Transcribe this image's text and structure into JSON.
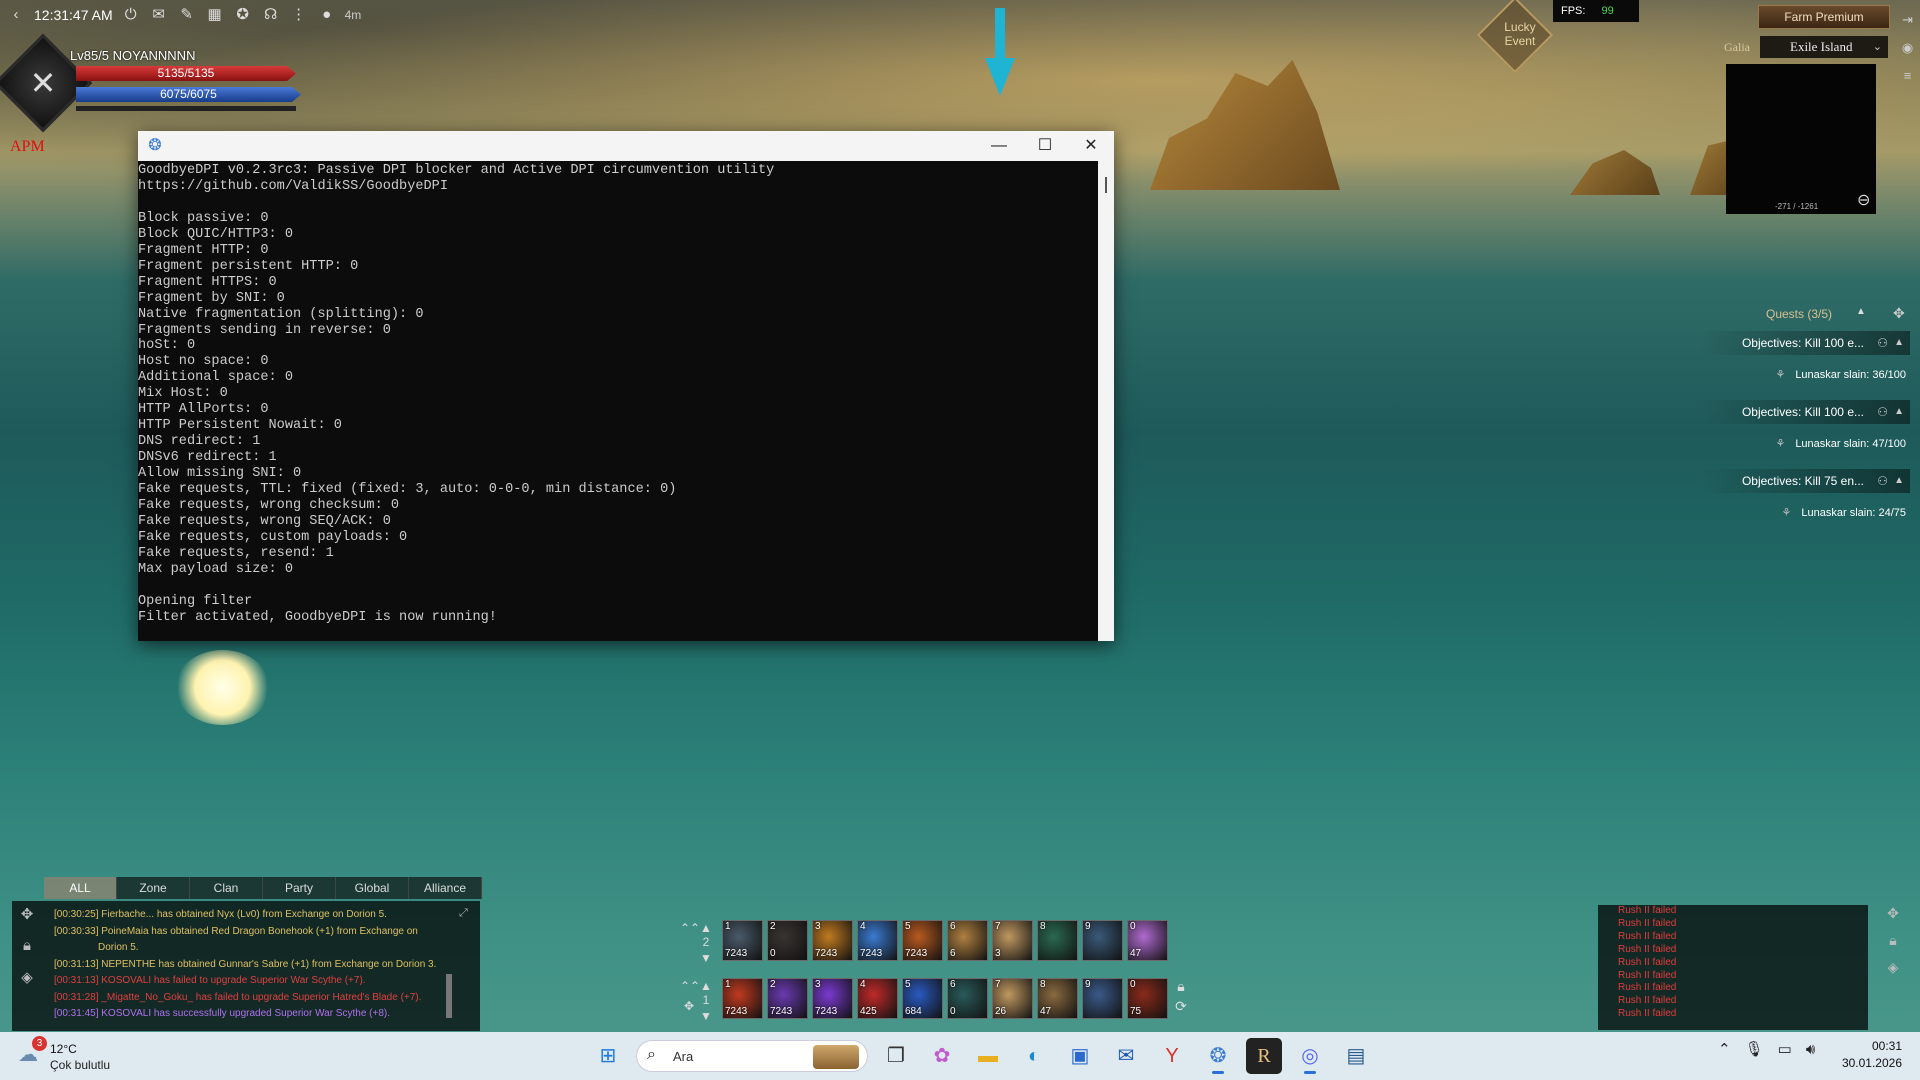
{
  "hud": {
    "time": "12:31:47 AM",
    "timer": "4m",
    "player_name": "Lv85/5 NOYANNNNN",
    "hp": "5135/5135",
    "mp": "6075/6075",
    "hp_fraction": 1.0,
    "mp_fraction": 1.0,
    "apm_label": "APM",
    "lucky_event": "Lucky Event",
    "fps_label": "FPS:",
    "fps_value": "99",
    "farm_premium": "Farm Premium",
    "region": "Galia",
    "zone": "Exile Island",
    "coords": "-271 / -1261"
  },
  "quests": {
    "header": "Quests (3/5)",
    "items": [
      {
        "objective": "Objectives: Kill 100 e...",
        "progress": "Lunaskar slain: 36/100"
      },
      {
        "objective": "Objectives: Kill 100 e...",
        "progress": "Lunaskar slain: 47/100"
      },
      {
        "objective": "Objectives: Kill 75 en...",
        "progress": "Lunaskar slain: 24/75"
      }
    ]
  },
  "console": {
    "lines": [
      "GoodbyeDPI v0.2.3rc3: Passive DPI blocker and Active DPI circumvention utility",
      "https://github.com/ValdikSS/GoodbyeDPI",
      "",
      "Block passive: 0",
      "Block QUIC/HTTP3: 0",
      "Fragment HTTP: 0",
      "Fragment persistent HTTP: 0",
      "Fragment HTTPS: 0",
      "Fragment by SNI: 0",
      "Native fragmentation (splitting): 0",
      "Fragments sending in reverse: 0",
      "hoSt: 0",
      "Host no space: 0",
      "Additional space: 0",
      "Mix Host: 0",
      "HTTP AllPorts: 0",
      "HTTP Persistent Nowait: 0",
      "DNS redirect: 1",
      "DNSv6 redirect: 1",
      "Allow missing SNI: 0",
      "Fake requests, TTL: fixed (fixed: 3, auto: 0-0-0, min distance: 0)",
      "Fake requests, wrong checksum: 0",
      "Fake requests, wrong SEQ/ACK: 0",
      "Fake requests, custom payloads: 0",
      "Fake requests, resend: 1",
      "Max payload size: 0",
      "",
      "Opening filter",
      "Filter activated, GoodbyeDPI is now running!"
    ]
  },
  "chat": {
    "tabs": [
      "ALL",
      "Zone",
      "Clan",
      "Party",
      "Global",
      "Alliance"
    ],
    "active_tab": "ALL",
    "lines": [
      {
        "text": "[00:30:25] Fierbache... has obtained Nyx (Lv0) from Exchange on Dorion 5.",
        "color": "#e0c060"
      },
      {
        "text": "[00:30:33] PoineMaia has obtained Red Dragon Bonehook (+1) from Exchange on",
        "color": "#e0c060"
      },
      {
        "text": "Dorion 5.",
        "color": "#e0c060"
      },
      {
        "text": "[00:31:13] NEPENTHE has obtained Gunnar's Sabre (+1) from Exchange on Dorion 3.",
        "color": "#e0c060"
      },
      {
        "text": "[00:31:13] KOSOVALI has failed to upgrade Superior War Scythe (+7).",
        "color": "#e04040"
      },
      {
        "text": "[00:31:28] _Migatte_No_Goku_ has failed to upgrade Superior Hatred's Blade (+7).",
        "color": "#e04040"
      },
      {
        "text": "[00:31:45] KOSOVALI has successfully upgraded Superior War Scythe (+8).",
        "color": "#b070f0"
      }
    ]
  },
  "skills": {
    "row1": [
      {
        "key": "1",
        "count": "7243",
        "color": "#4a5a6a"
      },
      {
        "key": "2",
        "count": "0",
        "color": "#3a3430"
      },
      {
        "key": "3",
        "count": "7243",
        "color": "#c07a20"
      },
      {
        "key": "4",
        "count": "7243",
        "color": "#3a7ad0"
      },
      {
        "key": "5",
        "count": "7243",
        "color": "#b85a20"
      },
      {
        "key": "6",
        "count": "6",
        "color": "#b08040"
      },
      {
        "key": "7",
        "count": "3",
        "color": "#c09860"
      },
      {
        "key": "8",
        "count": "",
        "color": "#2a6a50"
      },
      {
        "key": "9",
        "count": "",
        "color": "#3a5a7a"
      },
      {
        "key": "0",
        "count": "47",
        "color": "#b06ad0"
      }
    ],
    "row2": [
      {
        "key": "1",
        "count": "7243",
        "color": "#c03a20"
      },
      {
        "key": "2",
        "count": "7243",
        "color": "#6a3ab0"
      },
      {
        "key": "3",
        "count": "7243",
        "color": "#7a3ad0"
      },
      {
        "key": "4",
        "count": "425",
        "color": "#c02a2a"
      },
      {
        "key": "5",
        "count": "684",
        "color": "#2a5ac0"
      },
      {
        "key": "6",
        "count": "0",
        "color": "#2a5a5a"
      },
      {
        "key": "7",
        "count": "26",
        "color": "#c09860"
      },
      {
        "key": "8",
        "count": "47",
        "color": "#8a6a40"
      },
      {
        "key": "9",
        "count": "",
        "color": "#3a5a8a"
      },
      {
        "key": "0",
        "count": "75",
        "color": "#8a2a1a"
      }
    ],
    "row1_page": "2",
    "row2_page": "1"
  },
  "combat_log": {
    "lines": [
      "Rush II failed",
      "Rush II failed",
      "Rush II failed",
      "Rush II failed",
      "Rush II failed",
      "Rush II failed",
      "Rush II failed",
      "Rush II failed",
      "Rush II failed"
    ]
  },
  "taskbar": {
    "weather_badge": "3",
    "temperature": "12°C",
    "weather": "Çok bulutlu",
    "search_placeholder": "Ara",
    "clock_time": "00:31",
    "clock_date": "30.01.2026"
  },
  "colors": {
    "hp_fill": "#d83a3a",
    "mp_fill": "#4a79d8",
    "fps_value": "#4ed84e",
    "arrow": "#1fb3d4"
  }
}
